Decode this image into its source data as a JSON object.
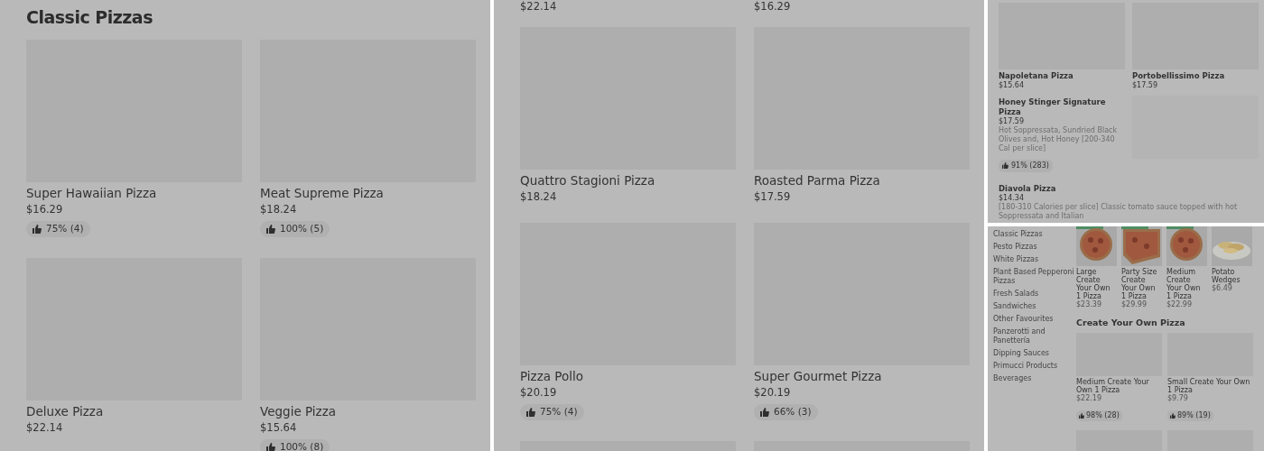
{
  "panels": [
    {
      "kind": "section",
      "heading": "Classic Pizzas",
      "items": [
        {
          "kind": "card",
          "name": "Super Hawaiian Pizza",
          "price": "$16.29",
          "rating": "75% (4)"
        },
        {
          "kind": "card",
          "name": "Meat Supreme Pizza",
          "price": "$18.24",
          "rating": "100% (5)"
        },
        {
          "kind": "card",
          "name": "Deluxe Pizza",
          "price": "$22.14"
        },
        {
          "kind": "card",
          "name": "Veggie Pizza",
          "price": "$15.64",
          "rating": "100% (8)"
        }
      ]
    },
    {
      "kind": "continued",
      "items": [
        {
          "kind": "price_only",
          "price": "$22.14"
        },
        {
          "kind": "price_only",
          "price": "$16.29"
        },
        {
          "kind": "card",
          "name": "Quattro Stagioni Pizza",
          "price": "$18.24"
        },
        {
          "kind": "card",
          "name": "Roasted Parma Pizza",
          "price": "$17.59"
        },
        {
          "kind": "card",
          "name": "Pizza Pollo",
          "price": "$20.19",
          "rating": "75% (4)"
        },
        {
          "kind": "card",
          "name": "Super Gourmet Pizza",
          "price": "$20.19",
          "rating": "66% (3)"
        },
        {
          "kind": "card"
        },
        {
          "kind": "card"
        }
      ]
    },
    {
      "kind": "compact",
      "items": [
        {
          "kind": "card",
          "name": "Napoletana Pizza",
          "price": "$15.64"
        },
        {
          "kind": "card",
          "name": "Portobellissimo Pizza",
          "price": "$17.59"
        },
        {
          "kind": "listing_with_image",
          "name": "Honey Stinger Signature Pizza",
          "price": "$17.59",
          "description": "Hot Soppressata, Sundried Black Olives and, Hot Honey [200-340 Cal per slice]",
          "rating": "91% (283)"
        },
        {
          "kind": "listing",
          "name": "Diavola Pizza",
          "price": "$14.34",
          "description": "[180-310 Calories per slice] Classic tomato sauce topped with hot Soppressata and Italian"
        }
      ]
    },
    {
      "kind": "store",
      "categories": [
        "Classic Pizzas",
        "Pesto Pizzas",
        "White Pizzas",
        "Plant Based Pepperoni Pizzas",
        "Fresh Salads",
        "Sandwiches",
        "Other Favourites",
        "Panzerotti and Panettería",
        "Dipping Sauces",
        "Primucci Products",
        "Beverages"
      ],
      "featured": [
        {
          "kind": "picture",
          "name": "Large Create Your Own 1 Pizza",
          "price": "$23.39"
        },
        {
          "kind": "picture",
          "name": "Party Size Create Your Own 1 Pizza",
          "price": "$29.99"
        },
        {
          "kind": "picture",
          "name": "Medium Create Your Own 1 Pizza",
          "price": "$22.99"
        },
        {
          "kind": "picture",
          "name": "Potato Wedges",
          "price": "$6.49"
        }
      ],
      "heading": "Create Your Own Pizza",
      "items": [
        {
          "kind": "card",
          "name": "Medium Create Your Own 1 Pizza",
          "price": "$22.19",
          "rating": "98% (28)"
        },
        {
          "kind": "card",
          "name": "Small Create Your Own 1 Pizza",
          "price": "$9.79",
          "rating": "89% (19)"
        },
        {
          "kind": "card"
        },
        {
          "kind": "card"
        }
      ]
    }
  ]
}
